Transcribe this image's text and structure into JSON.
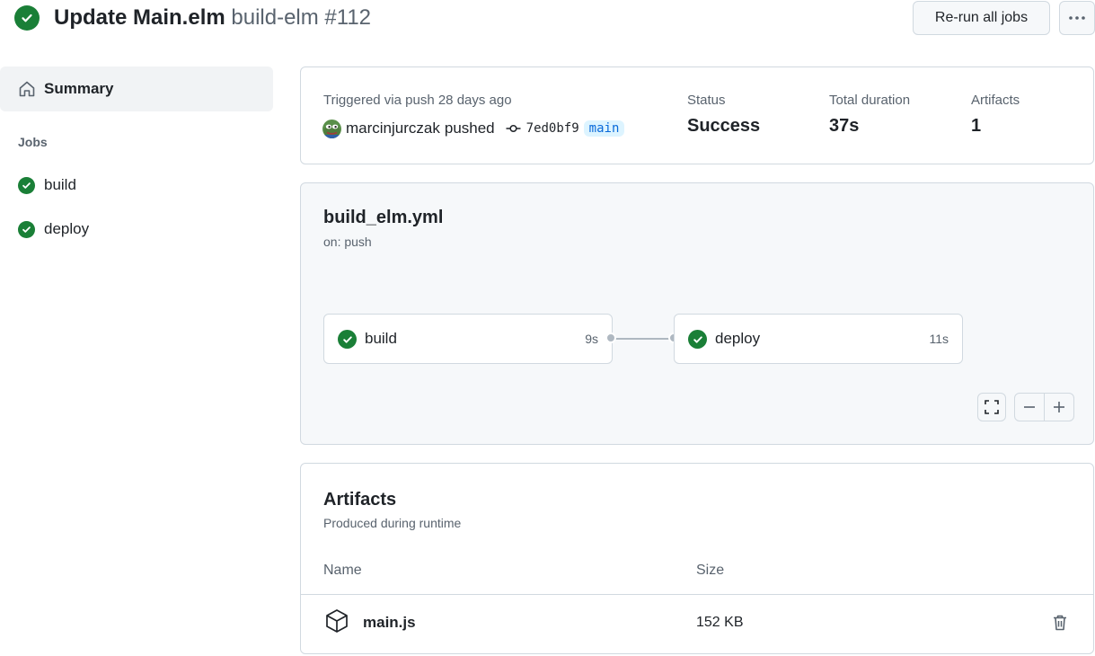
{
  "header": {
    "title": "Update Main.elm",
    "subtitle": "build-elm #112",
    "rerun_label": "Re-run all jobs",
    "more_icon": "kebab-horizontal-icon"
  },
  "sidebar": {
    "summary_label": "Summary",
    "jobs_heading": "Jobs",
    "jobs": [
      {
        "label": "build",
        "status": "success"
      },
      {
        "label": "deploy",
        "status": "success"
      }
    ]
  },
  "summary": {
    "triggered": "Triggered via push 28 days ago",
    "actor": "marcinjurczak",
    "action": "pushed",
    "commit": "7ed0bf9",
    "branch": "main",
    "status_label": "Status",
    "status_value": "Success",
    "duration_label": "Total duration",
    "duration_value": "37s",
    "artifacts_label": "Artifacts",
    "artifacts_value": "1"
  },
  "workflow": {
    "file": "build_elm.yml",
    "trigger": "on: push",
    "jobs": [
      {
        "name": "build",
        "duration": "9s"
      },
      {
        "name": "deploy",
        "duration": "11s"
      }
    ]
  },
  "artifacts": {
    "heading": "Artifacts",
    "subheading": "Produced during runtime",
    "columns": [
      "Name",
      "Size"
    ],
    "rows": [
      {
        "name": "main.js",
        "size": "152 KB"
      }
    ]
  },
  "colors": {
    "success": "#1a7f37",
    "branch_bg": "#ddf4ff",
    "branch_fg": "#0969da",
    "border": "#d1d9e0"
  }
}
